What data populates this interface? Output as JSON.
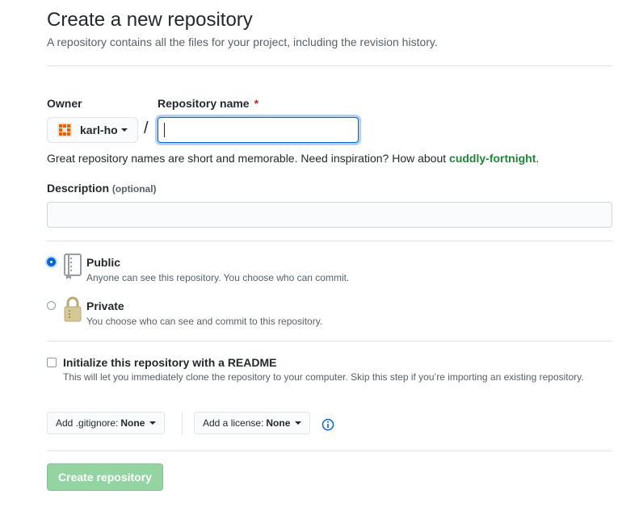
{
  "header": {
    "title": "Create a new repository",
    "subtitle": "A repository contains all the files for your project, including the revision history."
  },
  "owner": {
    "label": "Owner",
    "name": "karl-ho",
    "avatar_icon": "identicon-avatar",
    "avatar_color": "#e36209"
  },
  "repo_name": {
    "label": "Repository name",
    "required_mark": "*",
    "value": "",
    "separator": "/"
  },
  "hint": {
    "text": "Great repository names are short and memorable. Need inspiration? How about ",
    "suggestion": "cuddly-fortnight",
    "end": "."
  },
  "description": {
    "label": "Description",
    "optional_label": "(optional)",
    "value": ""
  },
  "visibility": {
    "public": {
      "title": "Public",
      "desc": "Anyone can see this repository. You choose who can commit.",
      "icon": "repo-book-icon",
      "checked": true
    },
    "private": {
      "title": "Private",
      "desc": "You choose who can see and commit to this repository.",
      "icon": "lock-icon",
      "checked": false
    }
  },
  "readme": {
    "title": "Initialize this repository with a README",
    "desc": "This will let you immediately clone the repository to your computer. Skip this step if you’re importing an existing repository.",
    "checked": false
  },
  "gitignore": {
    "label": "Add .gitignore:",
    "value": "None"
  },
  "license": {
    "label": "Add a license:",
    "value": "None"
  },
  "create_button": {
    "label": "Create repository"
  },
  "colors": {
    "accent": "#0366d6",
    "success_disabled": "#94d3a2",
    "suggestion": "#22863a",
    "required": "#cb2431"
  }
}
